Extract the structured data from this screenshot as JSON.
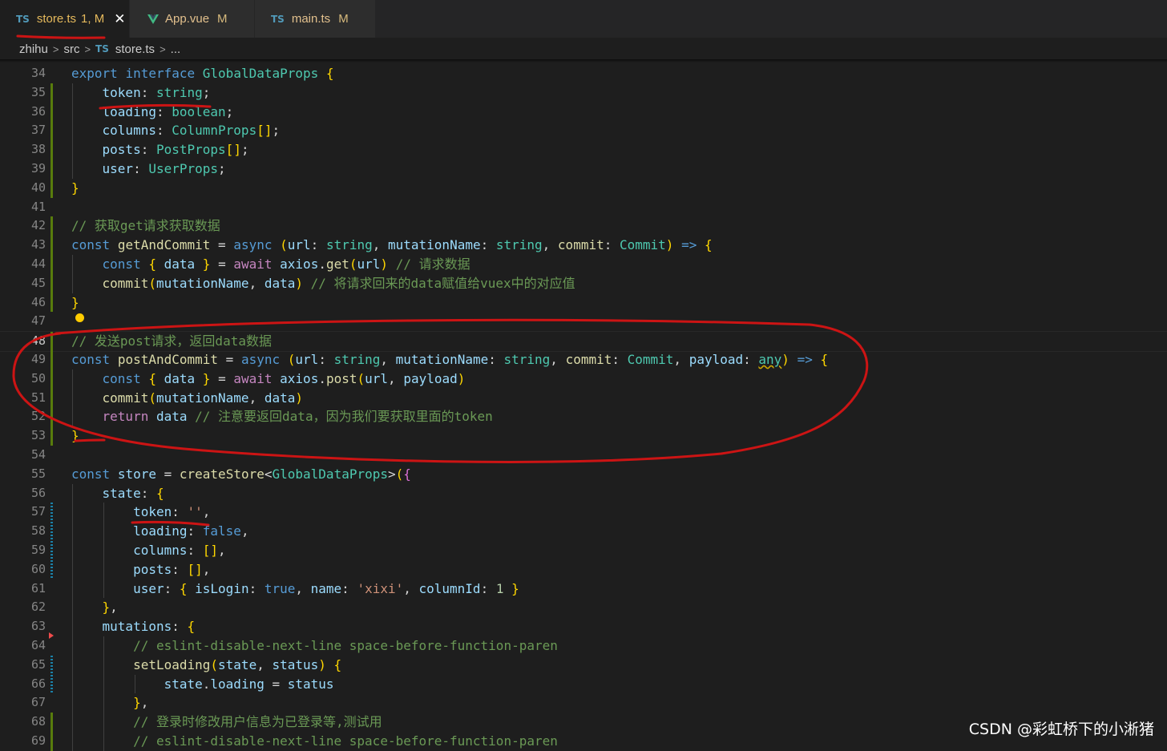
{
  "tabs": [
    {
      "icon": "TS",
      "name": "store.ts",
      "status": "1, M",
      "active": true
    },
    {
      "icon": "vue-logo",
      "name": "App.vue",
      "status": "M"
    },
    {
      "icon": "TS",
      "name": "main.ts",
      "status": "M"
    }
  ],
  "breadcrumb": {
    "parts": [
      "zhihu",
      "src"
    ],
    "file_icon": "TS",
    "file": "store.ts",
    "more": "..."
  },
  "editor": {
    "current_line": 48,
    "line_numbers": [
      "34",
      "35",
      "36",
      "37",
      "38",
      "39",
      "40",
      "41",
      "42",
      "43",
      "44",
      "45",
      "46",
      "47",
      "48",
      "49",
      "50",
      "51",
      "52",
      "53",
      "54",
      "55",
      "56",
      "57",
      "58",
      "59",
      "60",
      "61",
      "62",
      "63",
      "64",
      "65",
      "66",
      "67",
      "68",
      "69"
    ],
    "lines": [
      "export interface GlobalDataProps {",
      "    token: string;",
      "    loading: boolean;",
      "    columns: ColumnProps[];",
      "    posts: PostProps[];",
      "    user: UserProps;",
      "}",
      "",
      "// 获取get请求获取数据",
      "const getAndCommit = async (url: string, mutationName: string, commit: Commit) => {",
      "    const { data } = await axios.get(url) // 请求数据",
      "    commit(mutationName, data) // 将请求回来的data赋值给vuex中的对应值",
      "}",
      "",
      "// 发送post请求，返回data数据",
      "const postAndCommit = async (url: string, mutationName: string, commit: Commit, payload: any) => {",
      "    const { data } = await axios.post(url, payload)",
      "    commit(mutationName, data)",
      "    return data // 注意要返回data，因为我们要获取里面的token",
      "}",
      "",
      "const store = createStore<GlobalDataProps>({",
      "    state: {",
      "        token: '',",
      "        loading: false,",
      "        columns: [],",
      "        posts: [],",
      "        user: { isLogin: true, name: 'xixi', columnId: 1 }",
      "    },",
      "    mutations: {",
      "        // eslint-disable-next-line space-before-function-paren",
      "        setLoading(state, status) {",
      "            state.loading = status",
      "        },",
      "        // 登录时修改用户信息为已登录等,测试用",
      "        // eslint-disable-next-line space-before-function-paren"
    ]
  },
  "watermark": "CSDN @彩虹桥下的小淅猪",
  "colors": {
    "annotation": "#cc1414",
    "background": "#1e1e1e",
    "added": "#587c0c",
    "modified": "#1b81a8"
  }
}
